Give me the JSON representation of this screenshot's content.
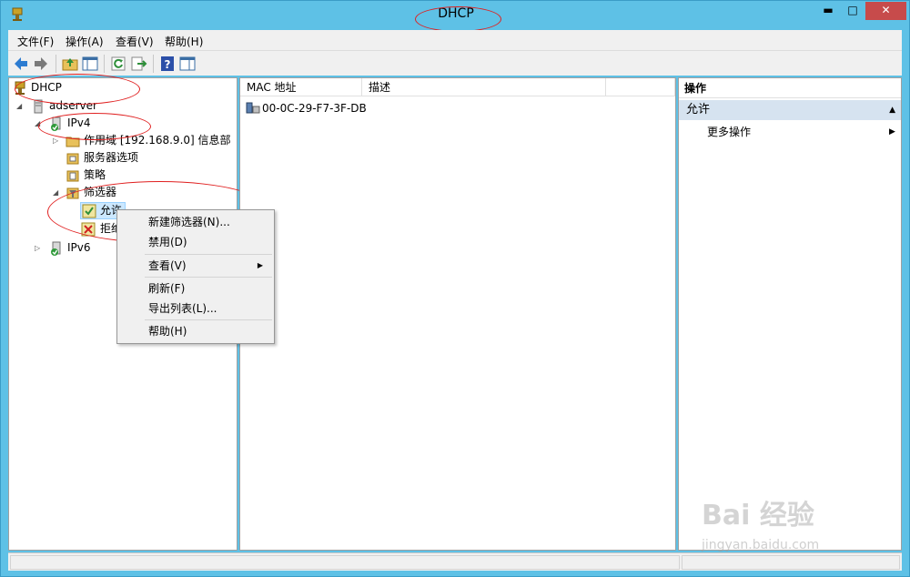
{
  "window": {
    "title": "DHCP"
  },
  "window_controls": {
    "minimize": "▬",
    "maximize": "□",
    "close": "✕"
  },
  "menubar": [
    "文件(F)",
    "操作(A)",
    "查看(V)",
    "帮助(H)"
  ],
  "toolbar": [
    "back-icon",
    "forward-icon",
    "up-folder-icon",
    "show-tree-icon",
    "refresh-icon",
    "export-icon",
    "help-icon",
    "show-action-pane-icon"
  ],
  "tree": {
    "root": "DHCP",
    "server": "adserver",
    "ipv4": "IPv4",
    "scope": "作用域 [192.168.9.0] 信息部",
    "server_options": "服务器选项",
    "policies": "策略",
    "filters": "筛选器",
    "allow": "允许",
    "deny": "拒绝",
    "ipv6": "IPv6"
  },
  "list": {
    "columns": [
      "MAC 地址",
      "描述"
    ],
    "rows": [
      {
        "mac": "00-0C-29-F7-3F-DB",
        "desc": ""
      }
    ]
  },
  "actions": {
    "header": "操作",
    "section": "允许",
    "items": [
      "更多操作"
    ]
  },
  "context_menu": {
    "items": [
      "新建筛选器(N)...",
      "禁用(D)",
      "查看(V)",
      "刷新(F)",
      "导出列表(L)...",
      "帮助(H)"
    ]
  },
  "watermark": {
    "main": "Bai 经验",
    "sub": "jingyan.baidu.com"
  },
  "colors": {
    "titlebar": "#5ec1e6",
    "annotation": "#e02020",
    "selection": "#d6e3f0"
  }
}
